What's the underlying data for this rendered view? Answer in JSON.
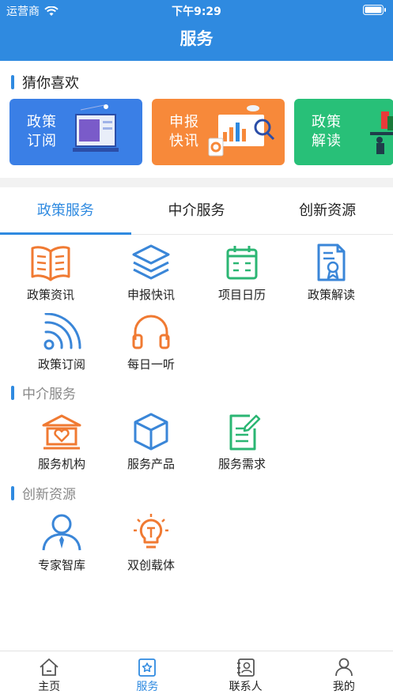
{
  "status_bar": {
    "carrier": "运营商",
    "time": "下午9:29"
  },
  "nav": {
    "title": "服务"
  },
  "guess": {
    "title": "猜你喜欢",
    "cards": [
      {
        "label": "政策订阅",
        "color": "#3a7fe6"
      },
      {
        "label": "申报快讯",
        "color": "#f7893a"
      },
      {
        "label": "政策解读",
        "color": "#28c078"
      }
    ]
  },
  "tabs": [
    {
      "label": "政策服务",
      "active": true
    },
    {
      "label": "中介服务",
      "active": false
    },
    {
      "label": "创新资源",
      "active": false
    }
  ],
  "policy_service": {
    "items": [
      {
        "label": "政策资讯",
        "icon": "open-book-icon"
      },
      {
        "label": "申报快讯",
        "icon": "layers-icon"
      },
      {
        "label": "项目日历",
        "icon": "calendar-icon"
      },
      {
        "label": "政策解读",
        "icon": "certificate-document-icon"
      },
      {
        "label": "政策订阅",
        "icon": "rss-icon"
      },
      {
        "label": "每日一听",
        "icon": "headphones-icon"
      }
    ]
  },
  "agency_service": {
    "title": "中介服务",
    "items": [
      {
        "label": "服务机构",
        "icon": "institution-icon"
      },
      {
        "label": "服务产品",
        "icon": "box-icon"
      },
      {
        "label": "服务需求",
        "icon": "edit-document-icon"
      }
    ]
  },
  "innovation": {
    "title": "创新资源",
    "items": [
      {
        "label": "专家智库",
        "icon": "expert-icon"
      },
      {
        "label": "双创载体",
        "icon": "lightbulb-icon"
      }
    ]
  },
  "bottom_nav": [
    {
      "label": "主页",
      "icon": "home-icon",
      "active": false
    },
    {
      "label": "服务",
      "icon": "service-icon",
      "active": true
    },
    {
      "label": "联系人",
      "icon": "contacts-icon",
      "active": false
    },
    {
      "label": "我的",
      "icon": "profile-icon",
      "active": false
    }
  ],
  "colors": {
    "primary": "#2f8ae0",
    "orange": "#f07a32",
    "green": "#2bb673",
    "blue_icon": "#3a86d8"
  }
}
